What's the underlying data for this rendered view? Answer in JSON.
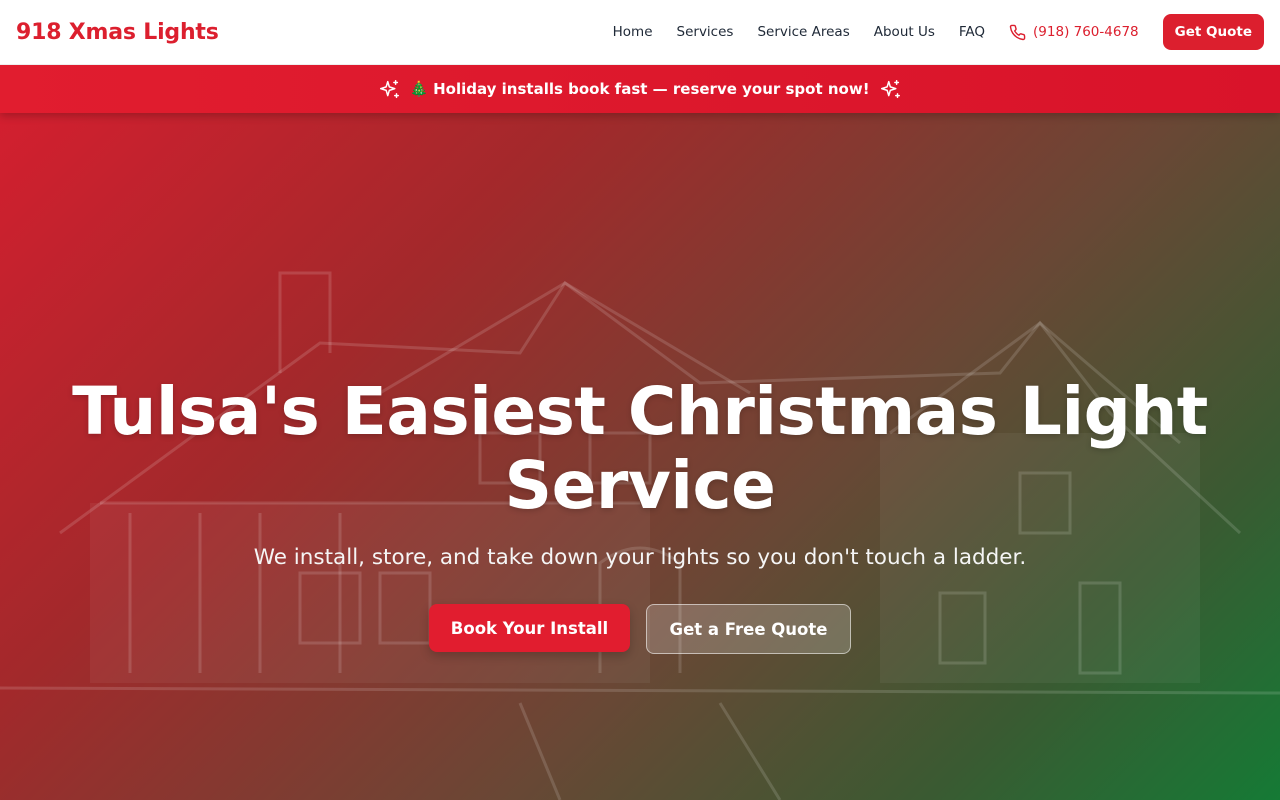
{
  "header": {
    "logo": "918 Xmas Lights",
    "nav": [
      "Home",
      "Services",
      "Service Areas",
      "About Us",
      "FAQ"
    ],
    "phone": "(918) 760-4678",
    "quote_button": "Get Quote"
  },
  "banner": {
    "tree_emoji": "🎄",
    "text": "Holiday installs book fast — reserve your spot now!"
  },
  "hero": {
    "title_line1": "Tulsa's Easiest Christmas Light",
    "title_line2": "Service",
    "subtitle": "We install, store, and take down your lights so you don't touch a ladder.",
    "primary_cta": "Book Your Install",
    "secondary_cta": "Get a Free Quote"
  },
  "colors": {
    "brand_red": "#dc1f2e",
    "hero_green": "#157a35",
    "header_bg": "#ffffff"
  },
  "icons": [
    "phone-icon",
    "sparkle-icon",
    "christmas-tree-icon"
  ]
}
